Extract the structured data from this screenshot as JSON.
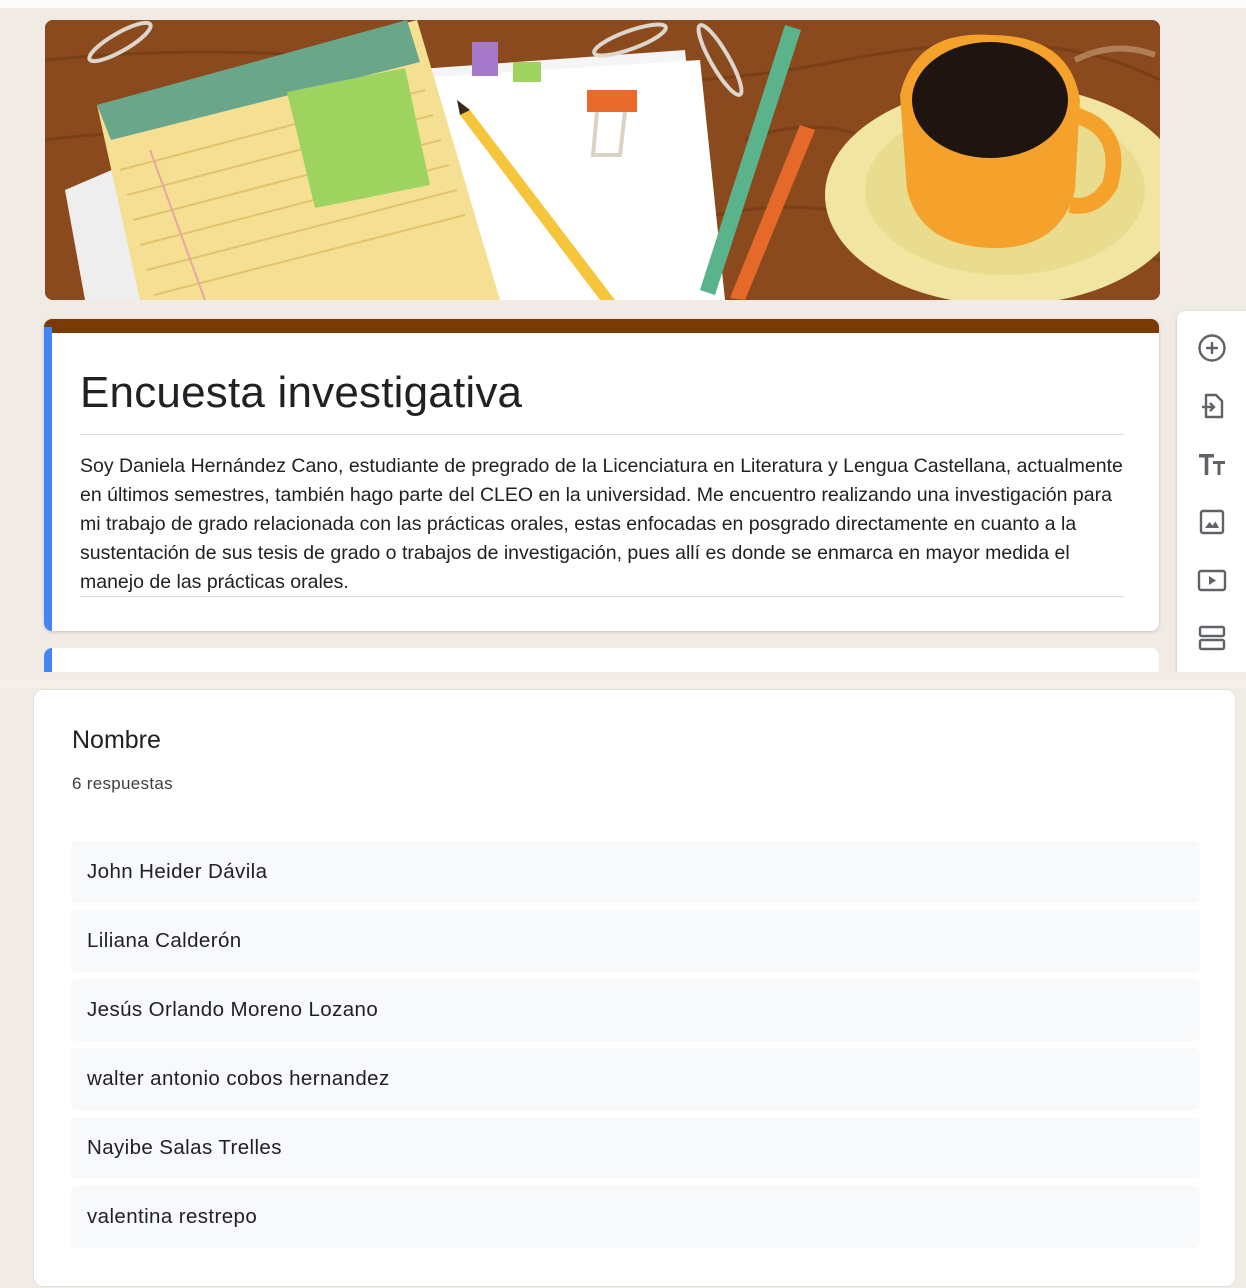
{
  "form": {
    "title": "Encuesta investigativa",
    "description": "Soy Daniela Hernández Cano, estudiante de pregrado de la Licenciatura en Literatura y Lengua Castellana, actualmente en últimos semestres, también hago parte del CLEO en la universidad. Me encuentro realizando una investigación para mi trabajo de grado relacionada con las prácticas orales, estas enfocadas en posgrado directamente en cuanto a la sustentación de sus tesis de grado o trabajos de investigación, pues allí es donde se enmarca en mayor medida el manejo de las prácticas orales.",
    "accent_color": "#7a3a06",
    "focus_color": "#4285f4"
  },
  "toolbar": {
    "items": [
      {
        "icon": "add-circle-icon"
      },
      {
        "icon": "import-questions-icon"
      },
      {
        "icon": "title-text-icon"
      },
      {
        "icon": "image-icon"
      },
      {
        "icon": "video-icon"
      },
      {
        "icon": "section-icon"
      }
    ]
  },
  "responses": {
    "question": "Nombre",
    "count_label": "6 respuestas",
    "answers": [
      "John Heider Dávila",
      "Liliana Calderón",
      "Jesús Orlando Moreno Lozano",
      "walter antonio cobos hernandez",
      "Nayibe Salas Trelles",
      "valentina restrepo"
    ]
  }
}
